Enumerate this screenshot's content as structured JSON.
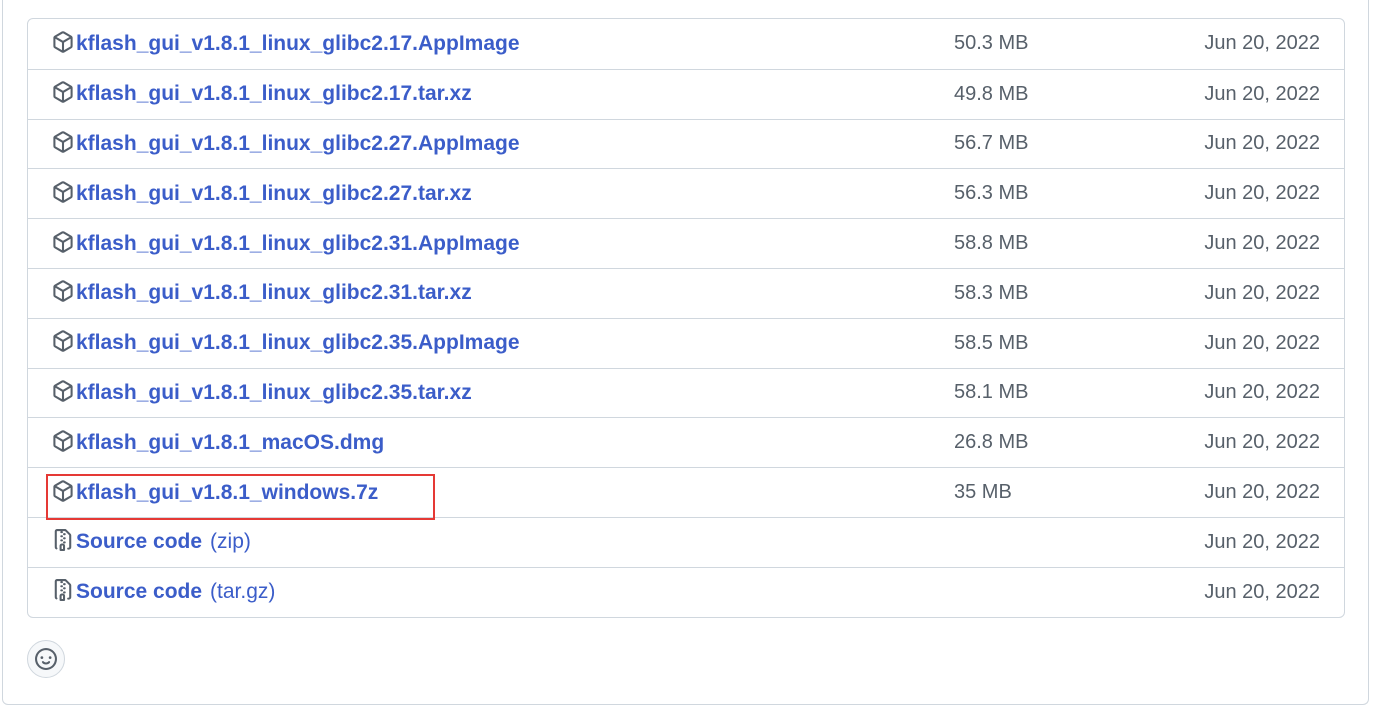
{
  "assets": [
    {
      "name": "kflash_gui_v1.8.1_linux_glibc2.17.AppImage",
      "size": "50.3 MB",
      "date": "Jun 20, 2022",
      "icon": "package-icon"
    },
    {
      "name": "kflash_gui_v1.8.1_linux_glibc2.17.tar.xz",
      "size": "49.8 MB",
      "date": "Jun 20, 2022",
      "icon": "package-icon"
    },
    {
      "name": "kflash_gui_v1.8.1_linux_glibc2.27.AppImage",
      "size": "56.7 MB",
      "date": "Jun 20, 2022",
      "icon": "package-icon"
    },
    {
      "name": "kflash_gui_v1.8.1_linux_glibc2.27.tar.xz",
      "size": "56.3 MB",
      "date": "Jun 20, 2022",
      "icon": "package-icon"
    },
    {
      "name": "kflash_gui_v1.8.1_linux_glibc2.31.AppImage",
      "size": "58.8 MB",
      "date": "Jun 20, 2022",
      "icon": "package-icon"
    },
    {
      "name": "kflash_gui_v1.8.1_linux_glibc2.31.tar.xz",
      "size": "58.3 MB",
      "date": "Jun 20, 2022",
      "icon": "package-icon"
    },
    {
      "name": "kflash_gui_v1.8.1_linux_glibc2.35.AppImage",
      "size": "58.5 MB",
      "date": "Jun 20, 2022",
      "icon": "package-icon"
    },
    {
      "name": "kflash_gui_v1.8.1_linux_glibc2.35.tar.xz",
      "size": "58.1 MB",
      "date": "Jun 20, 2022",
      "icon": "package-icon"
    },
    {
      "name": "kflash_gui_v1.8.1_macOS.dmg",
      "size": "26.8 MB",
      "date": "Jun 20, 2022",
      "icon": "package-icon"
    },
    {
      "name": "kflash_gui_v1.8.1_windows.7z",
      "size": "35 MB",
      "date": "Jun 20, 2022",
      "icon": "package-icon",
      "highlighted": true
    }
  ],
  "source_code": [
    {
      "label": "Source code",
      "format": "(zip)",
      "date": "Jun 20, 2022",
      "icon": "file-zip-icon"
    },
    {
      "label": "Source code",
      "format": "(tar.gz)",
      "date": "Jun 20, 2022",
      "icon": "file-zip-icon"
    }
  ],
  "colors": {
    "link": "#3b5dc9",
    "muted": "#57606a",
    "border": "#d0d7de",
    "highlight": "#e53935"
  },
  "reaction_button": {
    "icon": "smiley-icon"
  }
}
